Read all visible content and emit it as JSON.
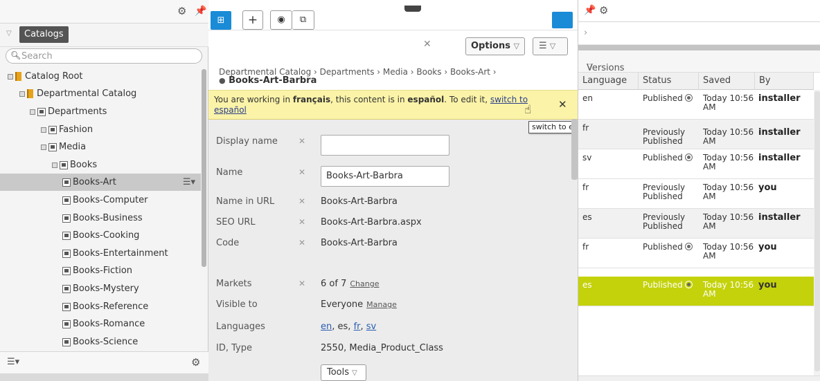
{
  "left": {
    "tab_label": "Catalogs",
    "search_placeholder": "Search",
    "tree": [
      {
        "label": "Catalog Root",
        "icon": "catalog-icon",
        "toggle": true
      },
      {
        "label": "Departmental Catalog",
        "icon": "catalog-icon",
        "toggle": true
      },
      {
        "label": "Departments",
        "icon": "node-icon",
        "toggle": true
      },
      {
        "label": "Fashion",
        "icon": "node-icon",
        "toggle": true
      },
      {
        "label": "Media",
        "icon": "node-icon",
        "toggle": true
      },
      {
        "label": "Books",
        "icon": "node-icon",
        "toggle": true
      },
      {
        "label": "Books-Art",
        "icon": "node-icon",
        "selected": true
      },
      {
        "label": "Books-Computer",
        "icon": "node-icon"
      },
      {
        "label": "Books-Business",
        "icon": "node-icon"
      },
      {
        "label": "Books-Cooking",
        "icon": "node-icon"
      },
      {
        "label": "Books-Entertainment",
        "icon": "node-icon"
      },
      {
        "label": "Books-Fiction",
        "icon": "node-icon"
      },
      {
        "label": "Books-Mystery",
        "icon": "node-icon"
      },
      {
        "label": "Books-Reference",
        "icon": "node-icon"
      },
      {
        "label": "Books-Romance",
        "icon": "node-icon"
      },
      {
        "label": "Books-Science",
        "icon": "node-icon"
      }
    ]
  },
  "mid": {
    "options_label": "Options",
    "breadcrumb": "Departmental Catalog › Departments › Media › Books › Books-Art ›",
    "content_title": "Books-Art-Barbra",
    "notice": {
      "pre": "You are working in ",
      "current_lang": "français",
      "mid": ", this content is in ",
      "content_lang": "español",
      "post": ". To edit it, ",
      "link": "switch to español"
    },
    "tooltip": "switch to español",
    "fields": {
      "display_name_label": "Display name",
      "display_name_value": "",
      "name_label": "Name",
      "name_value": "Books-Art-Barbra",
      "name_in_url_label": "Name in URL",
      "name_in_url_value": "Books-Art-Barbra",
      "seo_url_label": "SEO URL",
      "seo_url_value": "Books-Art-Barbra.aspx",
      "code_label": "Code",
      "code_value": "Books-Art-Barbra",
      "markets_label": "Markets",
      "markets_value": "6 of 7",
      "markets_link": "Change",
      "visible_label": "Visible to",
      "visible_value": "Everyone",
      "visible_link": "Manage",
      "languages_label": "Languages",
      "languages_links": [
        "en",
        "es",
        "fr",
        "sv"
      ],
      "id_type_label": "ID, Type",
      "id_type_value": "2550, Media_Product_Class"
    },
    "tools_label": "Tools"
  },
  "right": {
    "versions_label": "Versions",
    "columns": [
      "Language",
      "Status",
      "Saved",
      "By"
    ],
    "rows": [
      {
        "language": "en",
        "status": "Published",
        "status2": "",
        "icon": true,
        "saved": "Today 10:56",
        "saved2": "AM",
        "by": "installer"
      },
      {
        "language": "fr",
        "status": "Previously",
        "status2": "Published",
        "icon": false,
        "saved": "Today 10:56",
        "saved2": "AM",
        "by": "installer"
      },
      {
        "language": "sv",
        "status": "Published",
        "status2": "",
        "icon": true,
        "saved": "Today 10:56",
        "saved2": "AM",
        "by": "installer"
      },
      {
        "language": "fr",
        "status": "Previously",
        "status2": "Published",
        "icon": false,
        "saved": "Today 10:56",
        "saved2": "AM",
        "by": "you"
      },
      {
        "language": "es",
        "status": "Previously",
        "status2": "Published",
        "icon": false,
        "saved": "Today 10:56",
        "saved2": "AM",
        "by": "installer"
      },
      {
        "language": "fr",
        "status": "Published",
        "status2": "",
        "icon": true,
        "saved": "Today 10:56",
        "saved2": "AM",
        "by": "you"
      },
      {
        "language": "es",
        "status": "Published",
        "status2": "",
        "icon": true,
        "saved": "Today 10:56",
        "saved2": "AM",
        "by": "you",
        "highlight": true
      }
    ],
    "highlight_color": "#c4d20b"
  },
  "colors": {
    "accent": "#1a8bd6",
    "notice": "#fbf3a8"
  }
}
